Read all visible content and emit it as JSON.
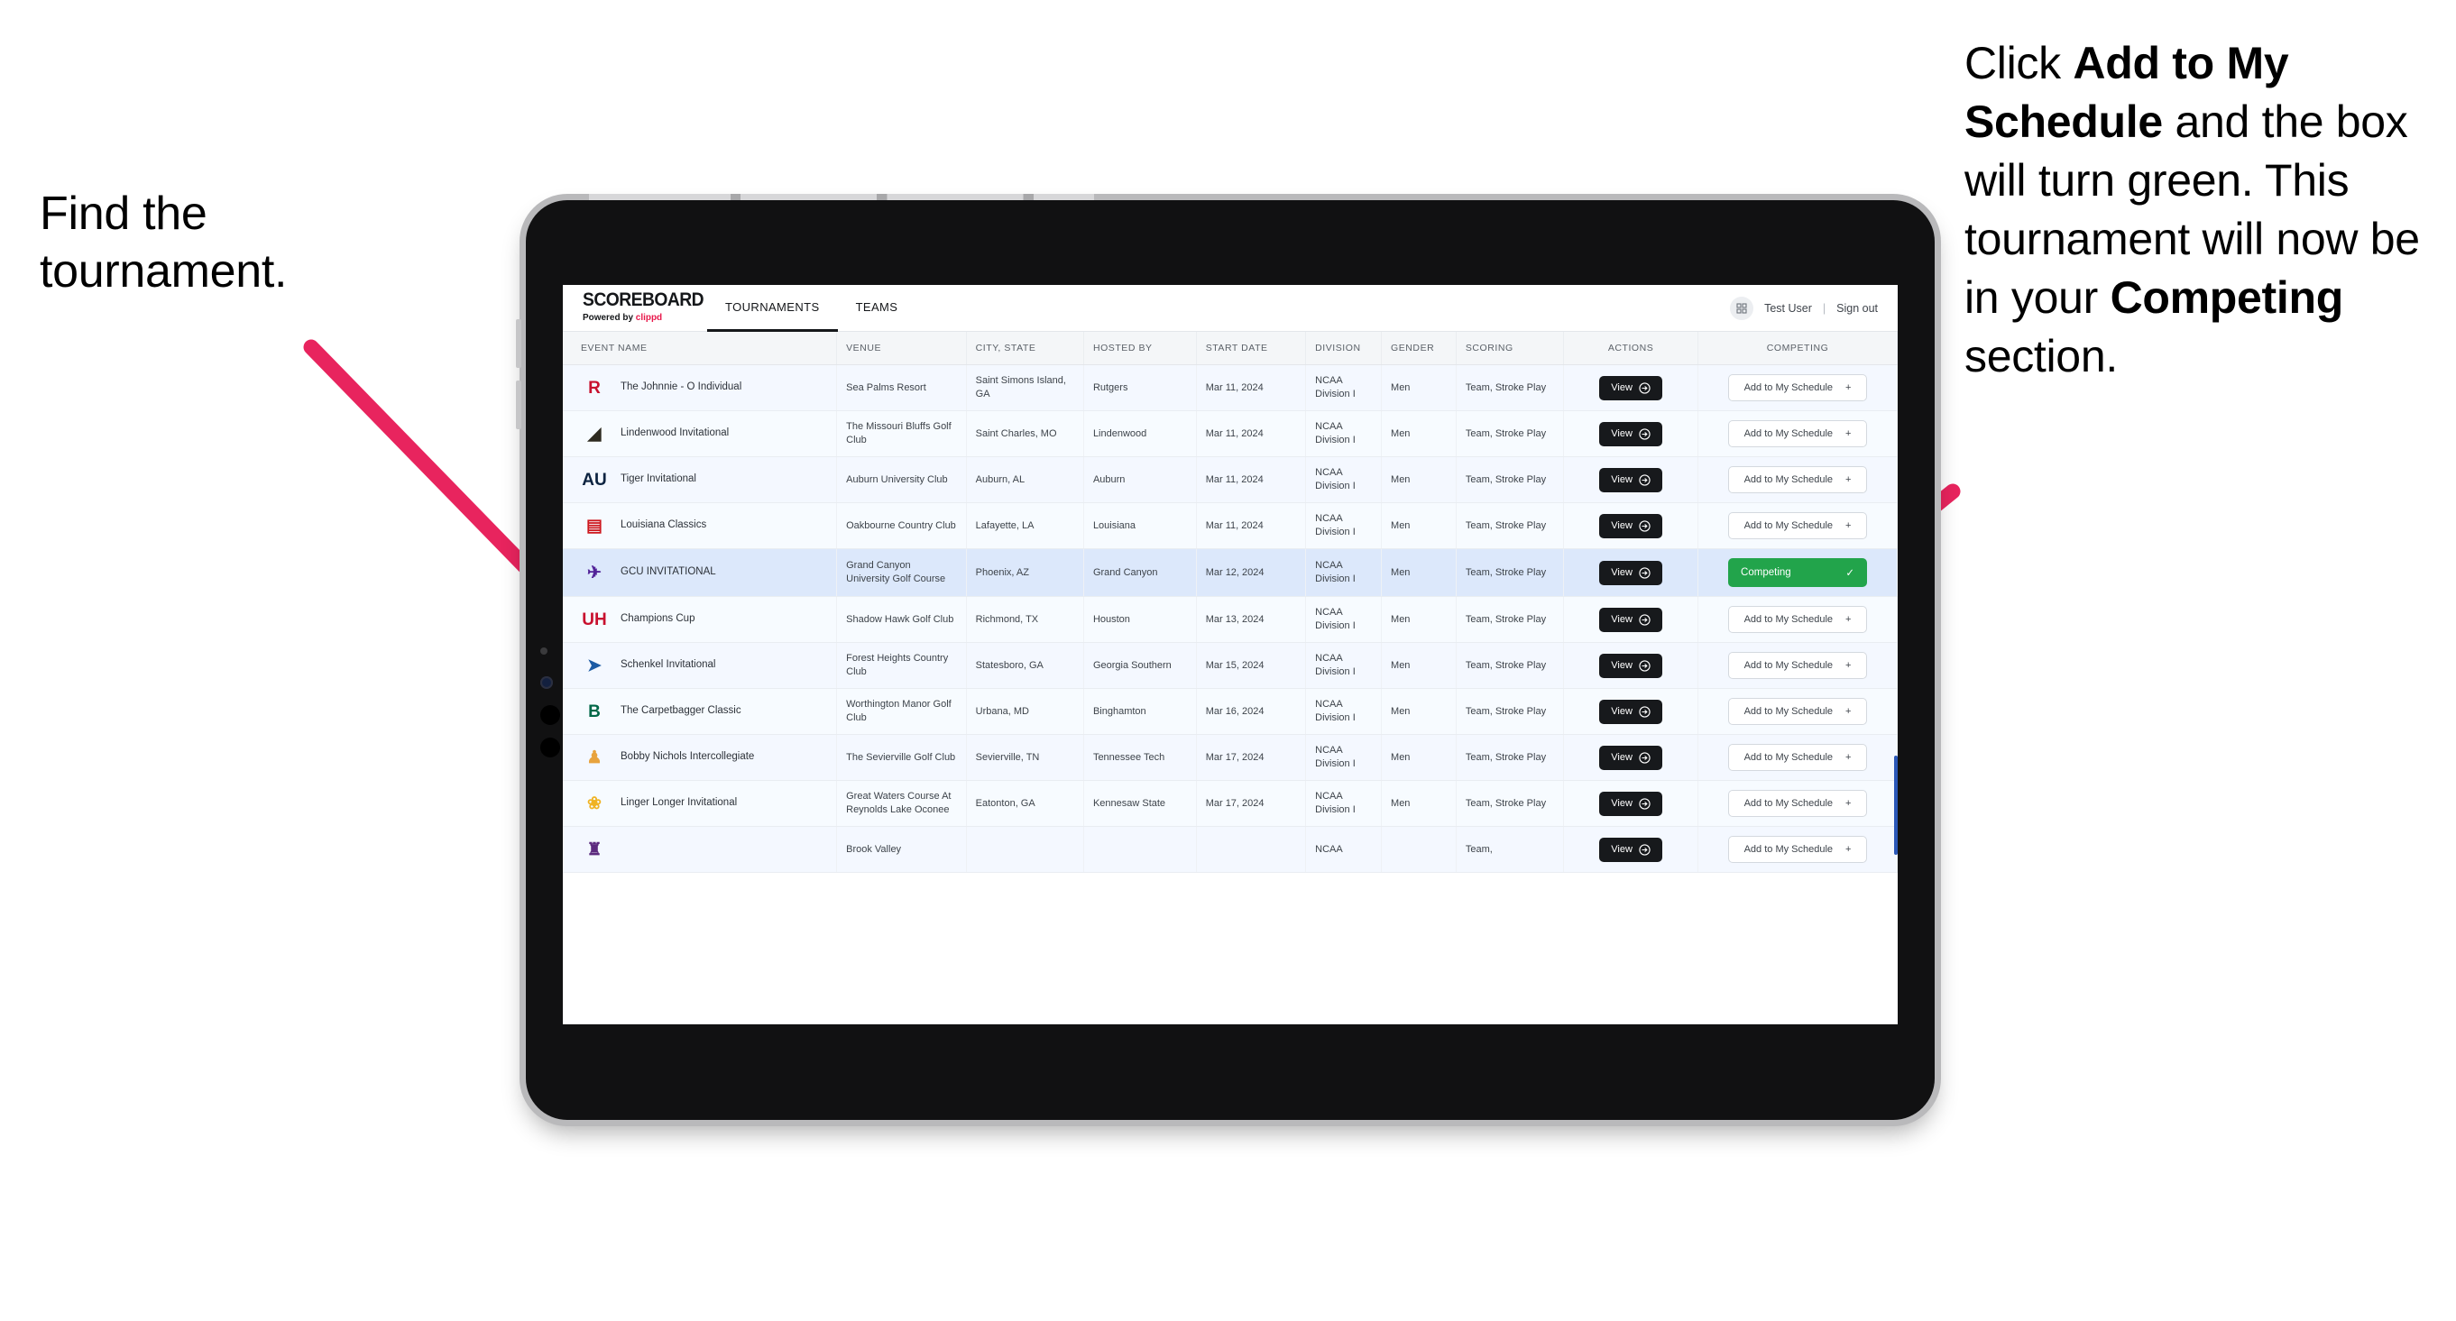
{
  "annotations": {
    "left": "Find the tournament.",
    "right_parts": [
      {
        "t": "Click ",
        "b": false
      },
      {
        "t": "Add to My Schedule",
        "b": true
      },
      {
        "t": " and the box will turn green. This tournament will now be in your ",
        "b": false
      },
      {
        "t": "Competing",
        "b": true
      },
      {
        "t": " section.",
        "b": false
      }
    ],
    "arrow_color": "#e8245e"
  },
  "app": {
    "brand": {
      "title": "SCOREBOARD",
      "powered_prefix": "Powered by ",
      "powered_brand": "clippd"
    },
    "nav": [
      {
        "label": "TOURNAMENTS",
        "active": true
      },
      {
        "label": "TEAMS",
        "active": false
      }
    ],
    "header_right": {
      "grid_icon": "grid-icon",
      "user": "Test User",
      "separator": "|",
      "signout": "Sign out"
    },
    "columns": [
      "EVENT NAME",
      "VENUE",
      "CITY, STATE",
      "HOSTED BY",
      "START DATE",
      "DIVISION",
      "GENDER",
      "SCORING",
      "ACTIONS",
      "COMPETING"
    ],
    "buttons": {
      "view": "View",
      "add": "Add to My Schedule",
      "add_plus": "+",
      "competing": "Competing",
      "competing_check": "✓"
    },
    "accent_green": "#22a44b",
    "accent_dark": "#17191c",
    "rows": [
      {
        "logo": {
          "glyph": "R",
          "color": "#c8102e",
          "bg": "transparent"
        },
        "event": "The Johnnie - O Individual",
        "venue": "Sea Palms Resort",
        "city": "Saint Simons Island, GA",
        "host": "Rutgers",
        "date": "Mar 11, 2024",
        "division": "NCAA Division I",
        "gender": "Men",
        "scoring": "Team, Stroke Play",
        "competing": false
      },
      {
        "logo": {
          "glyph": "◢",
          "color": "#2e2a20",
          "bg": "transparent"
        },
        "event": "Lindenwood Invitational",
        "venue": "The Missouri Bluffs Golf Club",
        "city": "Saint Charles, MO",
        "host": "Lindenwood",
        "date": "Mar 11, 2024",
        "division": "NCAA Division I",
        "gender": "Men",
        "scoring": "Team, Stroke Play",
        "competing": false
      },
      {
        "logo": {
          "glyph": "AU",
          "color": "#0c2340",
          "bg": "transparent"
        },
        "event": "Tiger Invitational",
        "venue": "Auburn University Club",
        "city": "Auburn, AL",
        "host": "Auburn",
        "date": "Mar 11, 2024",
        "division": "NCAA Division I",
        "gender": "Men",
        "scoring": "Team, Stroke Play",
        "competing": false
      },
      {
        "logo": {
          "glyph": "▤",
          "color": "#ce181e",
          "bg": "transparent"
        },
        "event": "Louisiana Classics",
        "venue": "Oakbourne Country Club",
        "city": "Lafayette, LA",
        "host": "Louisiana",
        "date": "Mar 11, 2024",
        "division": "NCAA Division I",
        "gender": "Men",
        "scoring": "Team, Stroke Play",
        "competing": false
      },
      {
        "logo": {
          "glyph": "✈",
          "color": "#522398",
          "bg": "transparent"
        },
        "event": "GCU INVITATIONAL",
        "venue": "Grand Canyon University Golf Course",
        "city": "Phoenix, AZ",
        "host": "Grand Canyon",
        "date": "Mar 12, 2024",
        "division": "NCAA Division I",
        "gender": "Men",
        "scoring": "Team, Stroke Play",
        "competing": true
      },
      {
        "logo": {
          "glyph": "UH",
          "color": "#c8102e",
          "bg": "transparent"
        },
        "event": "Champions Cup",
        "venue": "Shadow Hawk Golf Club",
        "city": "Richmond, TX",
        "host": "Houston",
        "date": "Mar 13, 2024",
        "division": "NCAA Division I",
        "gender": "Men",
        "scoring": "Team, Stroke Play",
        "competing": false
      },
      {
        "logo": {
          "glyph": "➤",
          "color": "#1c5ba4",
          "bg": "transparent"
        },
        "event": "Schenkel Invitational",
        "venue": "Forest Heights Country Club",
        "city": "Statesboro, GA",
        "host": "Georgia Southern",
        "date": "Mar 15, 2024",
        "division": "NCAA Division I",
        "gender": "Men",
        "scoring": "Team, Stroke Play",
        "competing": false
      },
      {
        "logo": {
          "glyph": "B",
          "color": "#006747",
          "bg": "transparent"
        },
        "event": "The Carpetbagger Classic",
        "venue": "Worthington Manor Golf Club",
        "city": "Urbana, MD",
        "host": "Binghamton",
        "date": "Mar 16, 2024",
        "division": "NCAA Division I",
        "gender": "Men",
        "scoring": "Team, Stroke Play",
        "competing": false
      },
      {
        "logo": {
          "glyph": "♟",
          "color": "#e8a33d",
          "bg": "transparent"
        },
        "event": "Bobby Nichols Intercollegiate",
        "venue": "The Sevierville Golf Club",
        "city": "Sevierville, TN",
        "host": "Tennessee Tech",
        "date": "Mar 17, 2024",
        "division": "NCAA Division I",
        "gender": "Men",
        "scoring": "Team, Stroke Play",
        "competing": false
      },
      {
        "logo": {
          "glyph": "❀",
          "color": "#f0b323",
          "bg": "transparent"
        },
        "event": "Linger Longer Invitational",
        "venue": "Great Waters Course At Reynolds Lake Oconee",
        "city": "Eatonton, GA",
        "host": "Kennesaw State",
        "date": "Mar 17, 2024",
        "division": "NCAA Division I",
        "gender": "Men",
        "scoring": "Team, Stroke Play",
        "competing": false
      },
      {
        "logo": {
          "glyph": "♜",
          "color": "#5c2a7e",
          "bg": "transparent"
        },
        "event": "",
        "venue": "Brook Valley",
        "city": "",
        "host": "",
        "date": "",
        "division": "NCAA",
        "gender": "",
        "scoring": "Team,",
        "competing": false,
        "clipped": true
      }
    ]
  }
}
